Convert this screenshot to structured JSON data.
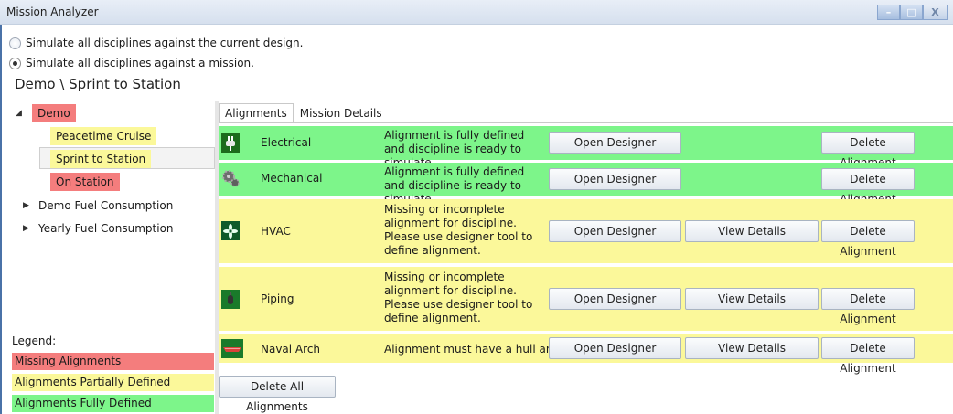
{
  "window": {
    "title": "Mission Analyzer",
    "controls": {
      "minimize": "–",
      "maximize": "□",
      "close": "X"
    }
  },
  "options": [
    {
      "label": "Simulate all disciplines against the current design.",
      "checked": false
    },
    {
      "label": "Simulate all disciplines against a mission.",
      "checked": true
    }
  ],
  "breadcrumb": "Demo \\ Sprint to Station",
  "tree": {
    "root": {
      "label": "Demo",
      "expanded": true,
      "status": "missing"
    },
    "children": [
      {
        "label": "Peacetime Cruise",
        "status": "partial"
      },
      {
        "label": "Sprint to Station",
        "status": "partial",
        "selected": true
      },
      {
        "label": "On Station",
        "status": "missing"
      }
    ],
    "others": [
      {
        "label": "Demo Fuel Consumption",
        "expanded": false
      },
      {
        "label": "Yearly Fuel Consumption",
        "expanded": false
      }
    ]
  },
  "legend": {
    "title": "Legend:",
    "items": [
      {
        "label": "Missing Alignments",
        "color": "#f47d7d"
      },
      {
        "label": "Alignments Partially Defined",
        "color": "#fbf89a"
      },
      {
        "label": "Alignments Fully Defined",
        "color": "#7df58a"
      }
    ]
  },
  "tabs": [
    {
      "label": "Alignments",
      "active": true
    },
    {
      "label": "Mission Details",
      "active": false
    }
  ],
  "alignments": [
    {
      "name": "Electrical",
      "status": "Alignment is fully defined and discipline is ready to simulate.",
      "state": "full",
      "icon": "electrical-icon"
    },
    {
      "name": "Mechanical",
      "status": "Alignment is fully defined and discipline is ready to simulate.",
      "state": "full",
      "icon": "gear-icon"
    },
    {
      "name": "HVAC",
      "status": "Missing or incomplete alignment for discipline. Please use designer tool to define alignment.",
      "state": "partial",
      "icon": "fan-icon"
    },
    {
      "name": "Piping",
      "status": "Missing or incomplete alignment for discipline. Please use designer tool to define alignment.",
      "state": "partial",
      "icon": "valve-icon"
    },
    {
      "name": "Naval Arch",
      "status": "Alignment must have a hull and",
      "state": "partial",
      "icon": "ship-icon"
    }
  ],
  "buttons": {
    "open_designer": "Open Designer",
    "view_details": "View Details",
    "delete_alignment": "Delete Alignment",
    "delete_all": "Delete All Alignments"
  },
  "colors": {
    "missing": "#f47d7d",
    "partial": "#fbf89a",
    "full": "#7df58a"
  }
}
